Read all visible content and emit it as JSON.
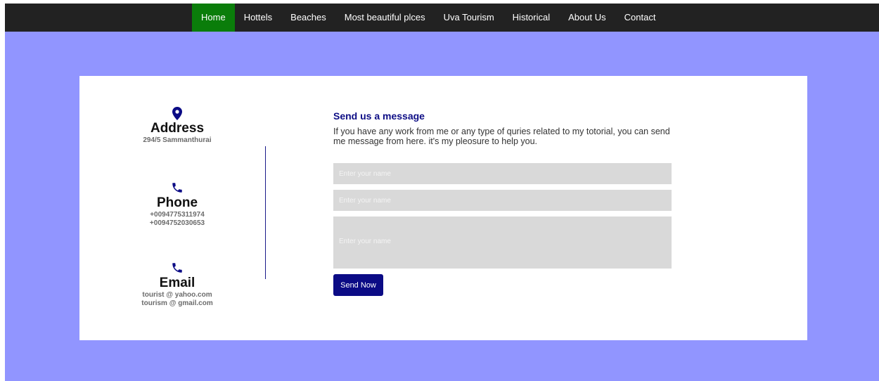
{
  "nav": {
    "items": [
      {
        "label": "Home",
        "active": true
      },
      {
        "label": "Hottels",
        "active": false
      },
      {
        "label": "Beaches",
        "active": false
      },
      {
        "label": "Most beautiful plces",
        "active": false
      },
      {
        "label": "Uva Tourism",
        "active": false
      },
      {
        "label": "Historical",
        "active": false
      },
      {
        "label": "About Us",
        "active": false
      },
      {
        "label": "Contact",
        "active": false
      }
    ]
  },
  "contact": {
    "address": {
      "icon": "map-pin-icon",
      "title": "Address",
      "lines": [
        "294/5 Sammanthurai"
      ]
    },
    "phone": {
      "icon": "phone-icon",
      "title": "Phone",
      "lines": [
        "+0094775311974",
        "+0094752030653"
      ]
    },
    "email": {
      "icon": "phone-icon",
      "title": "Email",
      "lines": [
        "tourist @ yahoo.com",
        "tourism @ gmail.com"
      ]
    }
  },
  "form": {
    "title": "Send us a message",
    "description": "If you have any work from me or any type of quries related to my totorial, you can send me message from here. it's my pleosure to help you.",
    "name_placeholder": "Enter your name",
    "email_placeholder": "Enter your name",
    "message_placeholder": "Enter your name",
    "send_label": "Send Now"
  },
  "colors": {
    "background": "#9195ff",
    "navbar": "#222222",
    "nav_active": "#0a7d0a",
    "accent": "#0b0b85",
    "field": "#d9d9d9"
  }
}
